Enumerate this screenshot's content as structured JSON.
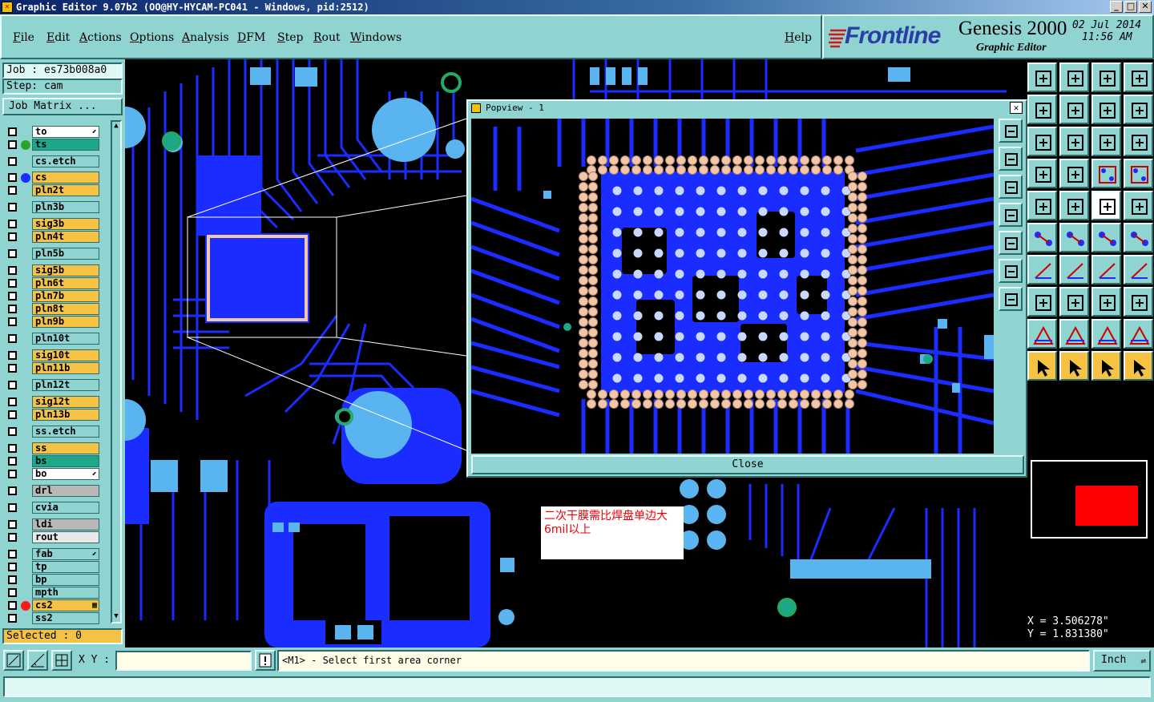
{
  "window": {
    "title": "Graphic Editor 9.07b2 (OO@HY-HYCAM-PC041 - Windows, pid:2512)"
  },
  "menu": {
    "items": [
      "File",
      "Edit",
      "Actions",
      "Options",
      "Analysis",
      "DFM",
      "Step",
      "Rout",
      "Windows"
    ],
    "help": "Help"
  },
  "brand": {
    "logo": "Frontline",
    "product": "Genesis 2000",
    "subtitle": "Graphic Editor",
    "date": "02 Jul 2014",
    "time": "11:56 AM"
  },
  "job": {
    "job_label": "Job : es73b008a0",
    "step_label": "Step: cam",
    "matrix_button": "Job Matrix ..."
  },
  "layers": [
    {
      "name": "to",
      "color": "#ffffff",
      "dot": "",
      "mark": "⬋"
    },
    {
      "name": "ts",
      "color": "#1ea88a",
      "dot": "#2aa52a",
      "mark": ""
    },
    {
      "name": "cs.etch",
      "color": "#8fd4d0",
      "dot": "",
      "mark": ""
    },
    {
      "name": "cs",
      "color": "#f5c244",
      "dot": "#1a2cff",
      "mark": ""
    },
    {
      "name": "pln2t",
      "color": "#f5c244",
      "dot": "",
      "mark": ""
    },
    {
      "name": "pln3b",
      "color": "#8fd4d0",
      "dot": "",
      "mark": ""
    },
    {
      "name": "sig3b",
      "color": "#f5c244",
      "dot": "",
      "mark": ""
    },
    {
      "name": "pln4t",
      "color": "#f5c244",
      "dot": "",
      "mark": ""
    },
    {
      "name": "pln5b",
      "color": "#8fd4d0",
      "dot": "",
      "mark": ""
    },
    {
      "name": "sig5b",
      "color": "#f5c244",
      "dot": "",
      "mark": ""
    },
    {
      "name": "pln6t",
      "color": "#f5c244",
      "dot": "",
      "mark": ""
    },
    {
      "name": "pln7b",
      "color": "#f5c244",
      "dot": "",
      "mark": ""
    },
    {
      "name": "pln8t",
      "color": "#f5c244",
      "dot": "",
      "mark": ""
    },
    {
      "name": "pln9b",
      "color": "#f5c244",
      "dot": "",
      "mark": ""
    },
    {
      "name": "pln10t",
      "color": "#8fd4d0",
      "dot": "",
      "mark": ""
    },
    {
      "name": "sig10t",
      "color": "#f5c244",
      "dot": "",
      "mark": ""
    },
    {
      "name": "pln11b",
      "color": "#f5c244",
      "dot": "",
      "mark": ""
    },
    {
      "name": "pln12t",
      "color": "#8fd4d0",
      "dot": "",
      "mark": ""
    },
    {
      "name": "sig12t",
      "color": "#f5c244",
      "dot": "",
      "mark": ""
    },
    {
      "name": "pln13b",
      "color": "#f5c244",
      "dot": "",
      "mark": ""
    },
    {
      "name": "ss.etch",
      "color": "#8fd4d0",
      "dot": "",
      "mark": ""
    },
    {
      "name": "ss",
      "color": "#f5c244",
      "dot": "",
      "mark": ""
    },
    {
      "name": "bs",
      "color": "#1ea88a",
      "dot": "",
      "mark": ""
    },
    {
      "name": "bo",
      "color": "#ffffff",
      "dot": "",
      "mark": "⬋"
    },
    {
      "name": "drl",
      "color": "#b8b8b8",
      "dot": "",
      "mark": ""
    },
    {
      "name": "cvia",
      "color": "#8fd4d0",
      "dot": "",
      "mark": ""
    },
    {
      "name": "ldi",
      "color": "#b8b8b8",
      "dot": "",
      "mark": ""
    },
    {
      "name": "rout",
      "color": "#e8e8e8",
      "dot": "",
      "mark": ""
    },
    {
      "name": "fab",
      "color": "#8fd4d0",
      "dot": "",
      "mark": "⬋"
    },
    {
      "name": "tp",
      "color": "#8fd4d0",
      "dot": "",
      "mark": ""
    },
    {
      "name": "bp",
      "color": "#8fd4d0",
      "dot": "",
      "mark": ""
    },
    {
      "name": "mpth",
      "color": "#8fd4d0",
      "dot": "",
      "mark": ""
    },
    {
      "name": "cs2",
      "color": "#f5c244",
      "dot": "#ff1a1a",
      "mark": "▦"
    },
    {
      "name": "ss2",
      "color": "#8fd4d0",
      "dot": "",
      "mark": ""
    }
  ],
  "selected": "Selected : 0",
  "popup": {
    "title": "Popview - 1",
    "close": "Close"
  },
  "note": {
    "text": "二次干膜需比焊盘单边大6mil以上"
  },
  "coords": {
    "x": "X = 3.506278\"",
    "y": "Y = 1.831380\""
  },
  "bottom": {
    "xy_label": "X Y :",
    "xy_value": "",
    "prompt": "<M1> - Select first area corner",
    "units": "Inch"
  },
  "colors": {
    "panel": "#8fd4d0",
    "layer_active": "#f5c244",
    "copper": "#1a2cff",
    "pad": "#5ab4f0",
    "canvas": "#000000"
  }
}
